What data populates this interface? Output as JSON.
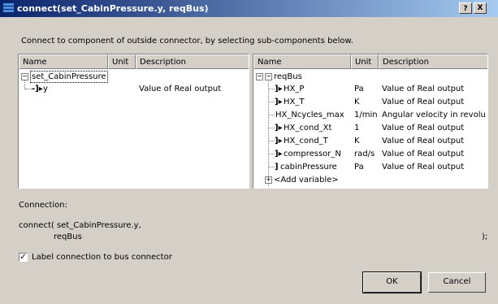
{
  "window": {
    "title": "connect(set_CabinPressure.y, reqBus)",
    "help_label": "?",
    "close_label": "X"
  },
  "instruction": "Connect to component of outside connector, by selecting sub-components below.",
  "left_table": {
    "headers": [
      "Name",
      "Unit",
      "Description"
    ],
    "root": "set_CabinPressure",
    "rows": [
      {
        "name": "y",
        "unit": "",
        "description": "Value of Real output"
      }
    ]
  },
  "right_table": {
    "headers": [
      "Name",
      "Unit",
      "Description"
    ],
    "root": "reqBus",
    "rows": [
      {
        "name": "HX_P",
        "unit": "Pa",
        "description": "Value of Real output"
      },
      {
        "name": "HX_T",
        "unit": "K",
        "description": "Value of Real output"
      },
      {
        "name": "HX_Ncycles_max",
        "unit": "1/min",
        "description": "Angular velocity in revolu..."
      },
      {
        "name": "HX_cond_Xt",
        "unit": "1",
        "description": "Value of Real output"
      },
      {
        "name": "HX_cond_T",
        "unit": "K",
        "description": "Value of Real output"
      },
      {
        "name": "compressor_N",
        "unit": "rad/s",
        "description": "Value of Real output"
      },
      {
        "name": "cabinPressure",
        "unit": "Pa",
        "description": "Value of Real output"
      }
    ],
    "add_variable": "<Add variable>"
  },
  "connection": {
    "label": "Connection:",
    "line1": "connect( set_CabinPressure.y,",
    "line2": "reqBus",
    "close": ");"
  },
  "checkbox": {
    "label": "Label connection to bus connector",
    "checked": true,
    "mark": "✓"
  },
  "buttons": {
    "ok": "OK",
    "cancel": "Cancel"
  }
}
